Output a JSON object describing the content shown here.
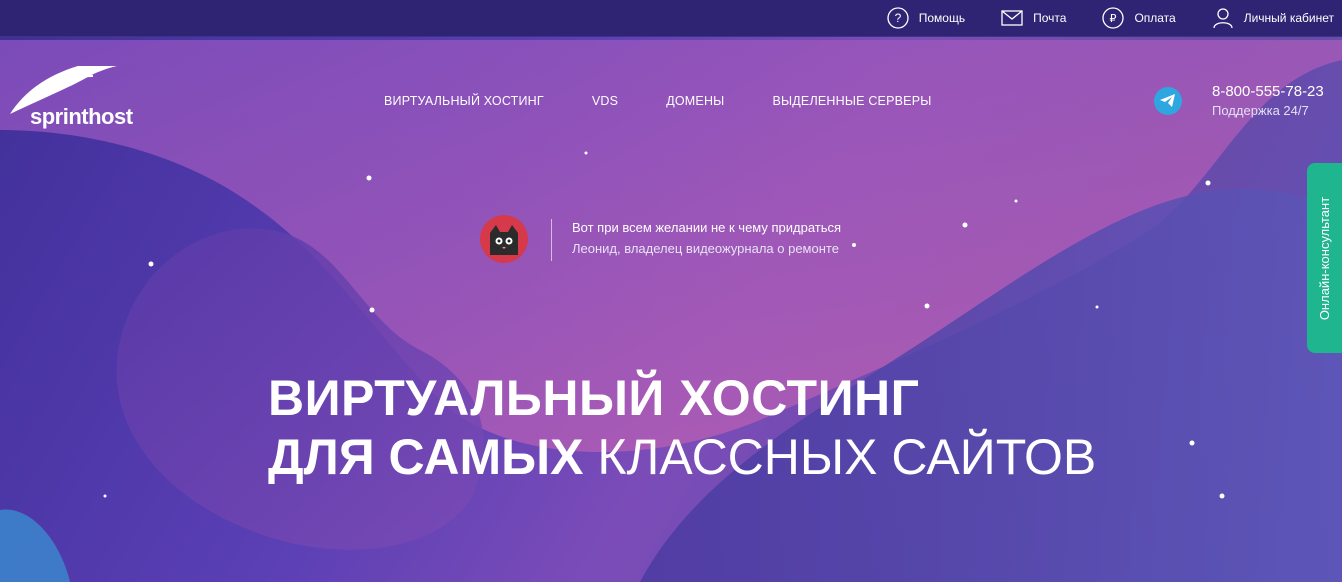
{
  "topbar": {
    "links": [
      {
        "label": "Помощь",
        "icon": "question-circle-icon"
      },
      {
        "label": "Почта",
        "icon": "envelope-icon"
      },
      {
        "label": "Оплата",
        "icon": "ruble-circle-icon"
      },
      {
        "label": "Личный кабинет",
        "icon": "user-icon"
      }
    ]
  },
  "header": {
    "logo_text": "sprinthost",
    "nav": [
      "ВИРТУАЛЬНЫЙ ХОСТИНГ",
      "VDS",
      "ДОМЕНЫ",
      "ВЫДЕЛЕННЫЕ СЕРВЕРЫ"
    ],
    "phone": "8-800-555-78-23",
    "support": "Поддержка 24/7"
  },
  "testimonial": {
    "quote": "Вот при всем желании не к чему придраться",
    "author": "Леонид, владелец видеожурнала о ремонте"
  },
  "hero": {
    "line1": "ВИРТУАЛЬНЫЙ ХОСТИНГ",
    "line2_bold": "ДЛЯ САМЫХ",
    "line2_light": "КЛАССНЫХ САЙТОВ"
  },
  "consultant": {
    "label": "Онлайн-консультант"
  },
  "colors": {
    "topbar": "#2f2373",
    "consultant": "#1fb58f",
    "telegram": "#2ea7e0",
    "avatar": "#d5394a"
  }
}
